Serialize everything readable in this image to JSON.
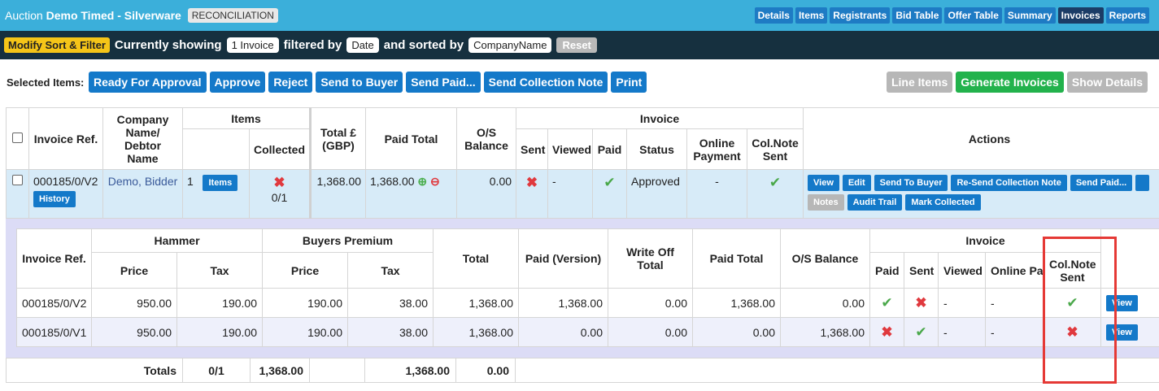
{
  "topbar": {
    "prefix": "Auction",
    "name": "Demo Timed - Silverware",
    "status": "RECONCILIATION",
    "tabs": [
      "Details",
      "Items",
      "Registrants",
      "Bid Table",
      "Offer Table",
      "Summary",
      "Invoices",
      "Reports"
    ],
    "active_tab": "Invoices"
  },
  "filterbar": {
    "modify": "Modify Sort & Filter",
    "currently": "Currently showing",
    "count": "1 Invoice",
    "filtered_by": "filtered by",
    "filter_value": "Date",
    "sorted_by": "and sorted by",
    "sort_value": "CompanyName",
    "reset": "Reset"
  },
  "actions": {
    "label": "Selected Items:",
    "left": [
      "Ready For Approval",
      "Approve",
      "Reject",
      "Send to Buyer",
      "Send Paid...",
      "Send Collection Note",
      "Print"
    ],
    "right": [
      "Line Items",
      "Generate Invoices",
      "Show Details"
    ]
  },
  "main_headers": {
    "invoice_ref": "Invoice Ref.",
    "company": "Company Name/ Debtor Name",
    "items": "Items",
    "collected": "Collected",
    "total": "Total £(GBP)",
    "paid_total": "Paid Total",
    "os_balance": "O/S Balance",
    "invoice": "Invoice",
    "sent": "Sent",
    "viewed": "Viewed",
    "paid": "Paid",
    "status": "Status",
    "online_payment": "Online Payment",
    "colnote_sent": "Col.Note Sent",
    "actions": "Actions"
  },
  "row": {
    "invoice_ref": "000185/0/V2",
    "history": "History",
    "company": "Demo, Bidder",
    "items_count": "1",
    "items_btn": "Items",
    "collected": "0/1",
    "total": "1,368.00",
    "paid_total": "1,368.00",
    "os_balance": "0.00",
    "viewed": "-",
    "status": "Approved",
    "online_payment": "-",
    "actions_row1": [
      "View",
      "Edit",
      "Send To Buyer",
      "Re-Send Collection Note",
      "Send Paid..."
    ],
    "actions_row2": [
      "Notes",
      "Audit Trail",
      "Mark Collected"
    ]
  },
  "sub_headers": {
    "invoice_ref": "Invoice Ref.",
    "hammer": "Hammer",
    "buyers_premium": "Buyers Premium",
    "price": "Price",
    "tax": "Tax",
    "total": "Total",
    "paid_version": "Paid (Version)",
    "write_off": "Write Off Total",
    "paid_total": "Paid Total",
    "os_balance": "O/S Balance",
    "invoice": "Invoice",
    "paid": "Paid",
    "sent": "Sent",
    "viewed": "Viewed",
    "online_payment": "Online Paymen",
    "colnote_sent": "Col.Note Sent"
  },
  "sub_rows": [
    {
      "ref": "000185/0/V2",
      "hammer_price": "950.00",
      "hammer_tax": "190.00",
      "bp_price": "190.00",
      "bp_tax": "38.00",
      "total": "1,368.00",
      "paid_version": "1,368.00",
      "write_off": "0.00",
      "paid_total": "1,368.00",
      "os_balance": "0.00",
      "paid": "check",
      "sent": "cross",
      "viewed": "-",
      "online": "-",
      "colnote": "check",
      "view": "View"
    },
    {
      "ref": "000185/0/V1",
      "hammer_price": "950.00",
      "hammer_tax": "190.00",
      "bp_price": "190.00",
      "bp_tax": "38.00",
      "total": "1,368.00",
      "paid_version": "0.00",
      "write_off": "0.00",
      "paid_total": "0.00",
      "os_balance": "1,368.00",
      "paid": "cross",
      "sent": "check",
      "viewed": "-",
      "online": "-",
      "colnote": "cross",
      "view": "View"
    }
  ],
  "totals": {
    "label": "Totals",
    "collected": "0/1",
    "total": "1,368.00",
    "paid_total": "1,368.00",
    "os_balance": "0.00"
  },
  "colors": {
    "topbar": "#3bafda",
    "filterbar": "#16303f",
    "blue_btn": "#1479c9",
    "highlight": "#e53935"
  }
}
